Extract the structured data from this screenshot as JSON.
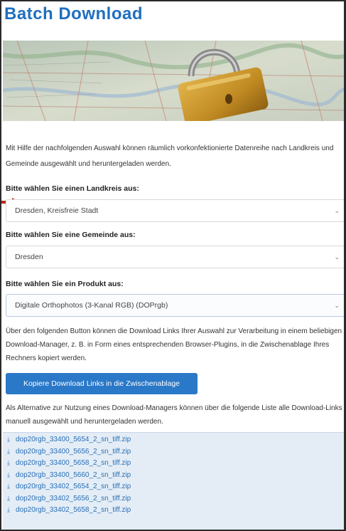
{
  "page": {
    "title": "Batch Download",
    "intro": "Mit Hilfe der nachfolgenden Auswahl können räumlich vorkonfektionierte Datenreihe nach Landkreis und Gemeinde ausgewählt und heruntergeladen werden.",
    "colors": {
      "title": "#1f6fbf",
      "button": "#2a78c8",
      "arrow": "#c0281e",
      "links_bg": "#e4edf6"
    }
  },
  "form": {
    "landkreis": {
      "label": "Bitte wählen Sie einen Landkreis aus:",
      "value": "Dresden, Kreisfreie Stadt"
    },
    "gemeinde": {
      "label": "Bitte wählen Sie eine Gemeinde aus:",
      "value": "Dresden"
    },
    "produkt": {
      "label": "Bitte wählen Sie ein Produkt aus:",
      "value": "Digitale Orthophotos (3-Kanal RGB) (DOPrgb)"
    }
  },
  "copy": {
    "description": "Über den folgenden Button können die Download Links Ihrer Auswahl zur Verarbeitung in einem beliebigen Download-Manager, z. B. in Form eines entsprechenden Browser-Plugins, in die Zwischenablage Ihres Rechners kopiert werden.",
    "button_label": "Kopiere Download Links in die Zwischenablage"
  },
  "alternative": {
    "text": "Als Alternative zur Nutzung eines Download-Managers können über die folgende Liste alle Download-Links manuell ausgewählt und heruntergeladen werden."
  },
  "downloads": {
    "icon": "download-icon",
    "items": [
      "dop20rgb_33400_5654_2_sn_tiff.zip",
      "dop20rgb_33400_5656_2_sn_tiff.zip",
      "dop20rgb_33400_5658_2_sn_tiff.zip",
      "dop20rgb_33400_5660_2_sn_tiff.zip",
      "dop20rgb_33402_5654_2_sn_tiff.zip",
      "dop20rgb_33402_5656_2_sn_tiff.zip",
      "dop20rgb_33402_5658_2_sn_tiff.zip"
    ]
  }
}
